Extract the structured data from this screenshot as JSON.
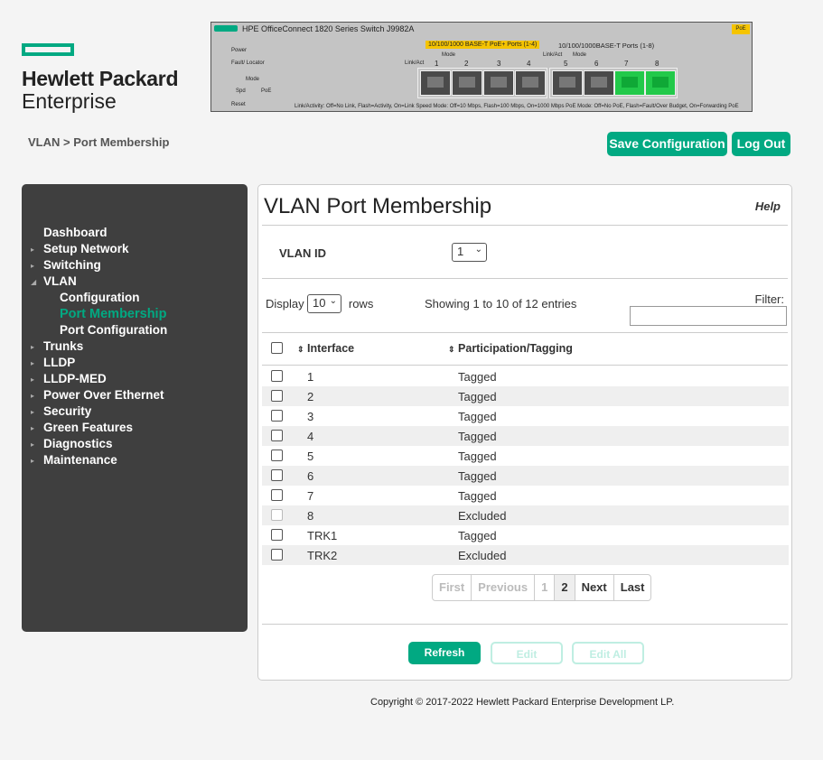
{
  "brand": {
    "line1": "Hewlett Packard",
    "line2": "Enterprise"
  },
  "device": {
    "title": "HPE OfficeConnect 1820 Series Switch J9982A",
    "poe_badge": "PoE",
    "group1": "10/100/1000 BASE-T PoE+ Ports (1-4)",
    "group2": "10/100/1000BASE-T Ports (1-8)",
    "power": "Power",
    "fault": "Fault/\nLocator",
    "mode": "Mode",
    "spd": "Spd",
    "poe": "PoE",
    "reset": "Reset",
    "linkact1": "Link/Act",
    "mode1": "Mode",
    "linkact2": "Link/Act",
    "mode2": "Mode",
    "ports": [
      "1",
      "2",
      "3",
      "4",
      "5",
      "6",
      "7",
      "8"
    ],
    "footer": "Link/Activity: Off=No Link, Flash=Activity, On=Link     Speed Mode: Off=10 Mbps, Flash=100 Mbps, On=1000 Mbps     PoE Mode: Off=No PoE, Flash=Fault/Over Budget, On=Forwarding PoE"
  },
  "breadcrumb": "VLAN > Port Membership",
  "header_buttons": {
    "save": "Save Configuration",
    "logout": "Log Out"
  },
  "nav": [
    {
      "label": "Dashboard",
      "caret": ""
    },
    {
      "label": "Setup Network",
      "caret": "▸"
    },
    {
      "label": "Switching",
      "caret": "▸"
    },
    {
      "label": "VLAN",
      "caret": "◢"
    },
    {
      "label": "Configuration",
      "caret": "",
      "sub": true
    },
    {
      "label": "Port Membership",
      "caret": "",
      "sub": true,
      "active": true
    },
    {
      "label": "Port Configuration",
      "caret": "",
      "sub": true
    },
    {
      "label": "Trunks",
      "caret": "▸"
    },
    {
      "label": "LLDP",
      "caret": "▸"
    },
    {
      "label": "LLDP-MED",
      "caret": "▸"
    },
    {
      "label": "Power Over Ethernet",
      "caret": "▸"
    },
    {
      "label": "Security",
      "caret": "▸"
    },
    {
      "label": "Green Features",
      "caret": "▸"
    },
    {
      "label": "Diagnostics",
      "caret": "▸"
    },
    {
      "label": "Maintenance",
      "caret": "▸"
    }
  ],
  "panel": {
    "title": "VLAN Port Membership",
    "help": "Help",
    "vlan_id_label": "VLAN ID",
    "vlan_id_value": "1",
    "display_prefix": "Display",
    "display_value": "10",
    "display_suffix": "rows",
    "showing": "Showing 1 to 10 of 12 entries",
    "filter_label": "Filter:"
  },
  "table": {
    "columns": [
      "Interface",
      "Participation/Tagging"
    ],
    "rows": [
      {
        "interface": "1",
        "tagging": "Tagged"
      },
      {
        "interface": "2",
        "tagging": "Tagged"
      },
      {
        "interface": "3",
        "tagging": "Tagged"
      },
      {
        "interface": "4",
        "tagging": "Tagged"
      },
      {
        "interface": "5",
        "tagging": "Tagged"
      },
      {
        "interface": "6",
        "tagging": "Tagged"
      },
      {
        "interface": "7",
        "tagging": "Tagged"
      },
      {
        "interface": "8",
        "tagging": "Excluded",
        "disabled": true
      },
      {
        "interface": "TRK1",
        "tagging": "Tagged"
      },
      {
        "interface": "TRK2",
        "tagging": "Excluded"
      }
    ]
  },
  "pagination": {
    "first": "First",
    "previous": "Previous",
    "page1": "1",
    "page2": "2",
    "next": "Next",
    "last": "Last"
  },
  "actions": {
    "refresh": "Refresh",
    "edit": "Edit",
    "edit_all": "Edit All"
  },
  "colors": {
    "accent": "#01a982",
    "sidebar": "#3f3f3f"
  },
  "copyright": "Copyright © 2017-2022 Hewlett Packard Enterprise Development LP."
}
